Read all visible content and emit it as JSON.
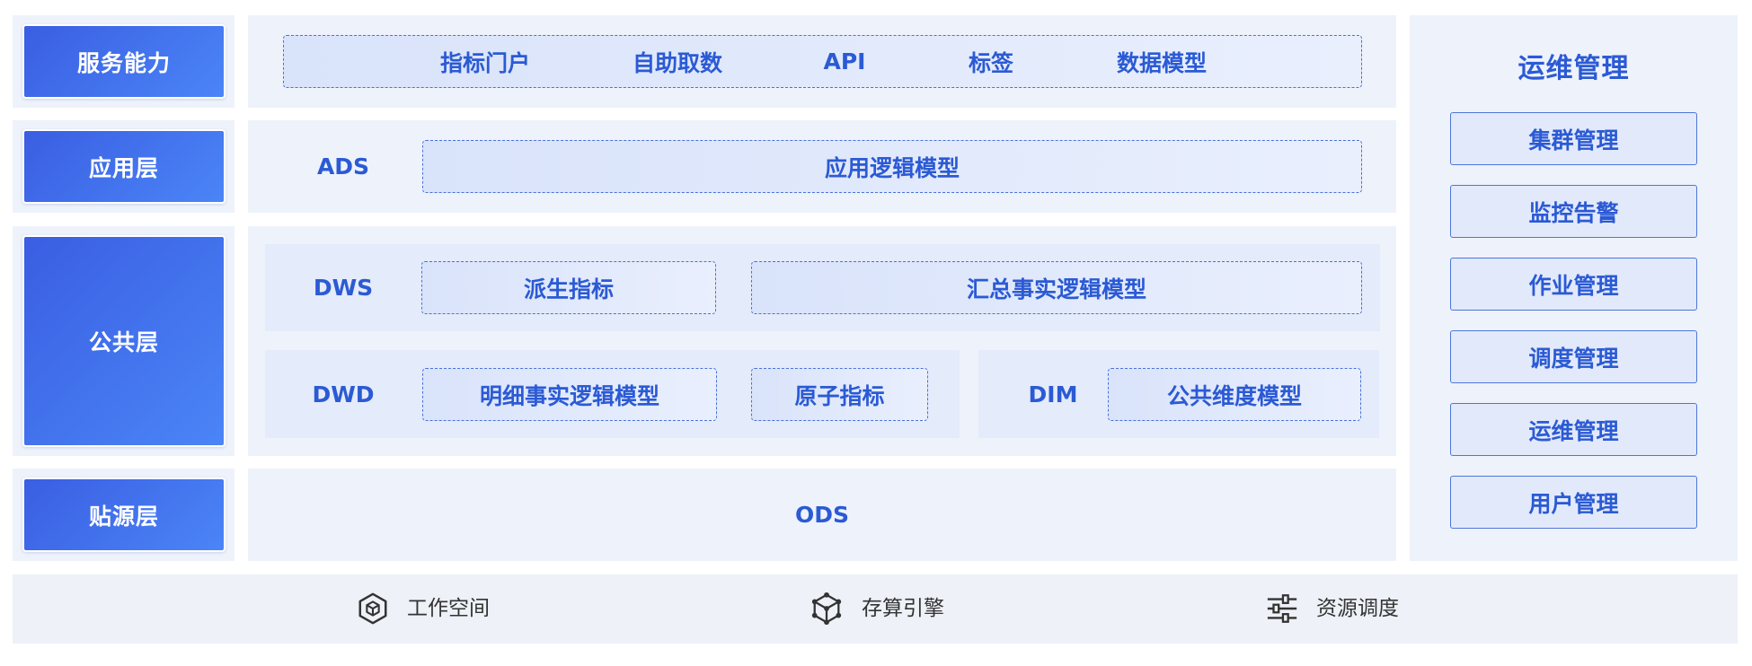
{
  "layers": {
    "service": {
      "label": "服务能力",
      "items": [
        "指标门户",
        "自助取数",
        "API",
        "标签",
        "数据模型"
      ]
    },
    "application": {
      "label": "应用层",
      "tag": "ADS",
      "model": "应用逻辑模型"
    },
    "common": {
      "label": "公共层",
      "dws": {
        "tag": "DWS",
        "derived_metrics": "派生指标",
        "summary_fact_model": "汇总事实逻辑模型"
      },
      "dwd": {
        "tag": "DWD",
        "detail_fact_model": "明细事实逻辑模型",
        "atomic_metrics": "原子指标"
      },
      "dim": {
        "tag": "DIM",
        "dimension_model": "公共维度模型"
      }
    },
    "source": {
      "label": "贴源层",
      "tag": "ODS"
    }
  },
  "ops": {
    "title": "运维管理",
    "items": [
      "集群管理",
      "监控告警",
      "作业管理",
      "调度管理",
      "运维管理",
      "用户管理"
    ]
  },
  "footer": {
    "items": [
      {
        "icon": "hexagon-cube-icon",
        "label": "工作空间"
      },
      {
        "icon": "network-cube-icon",
        "label": "存算引擎"
      },
      {
        "icon": "sliders-icon",
        "label": "资源调度"
      }
    ]
  },
  "colors": {
    "accent_text": "#2b5ad4",
    "layer_box_start": "#3a5ee2",
    "layer_box_end": "#4b85f7",
    "panel_bg": "#eef2fb",
    "subpanel_bg": "#e4ebfa",
    "footer_bg": "#eef1f7",
    "footer_text": "#333333"
  }
}
